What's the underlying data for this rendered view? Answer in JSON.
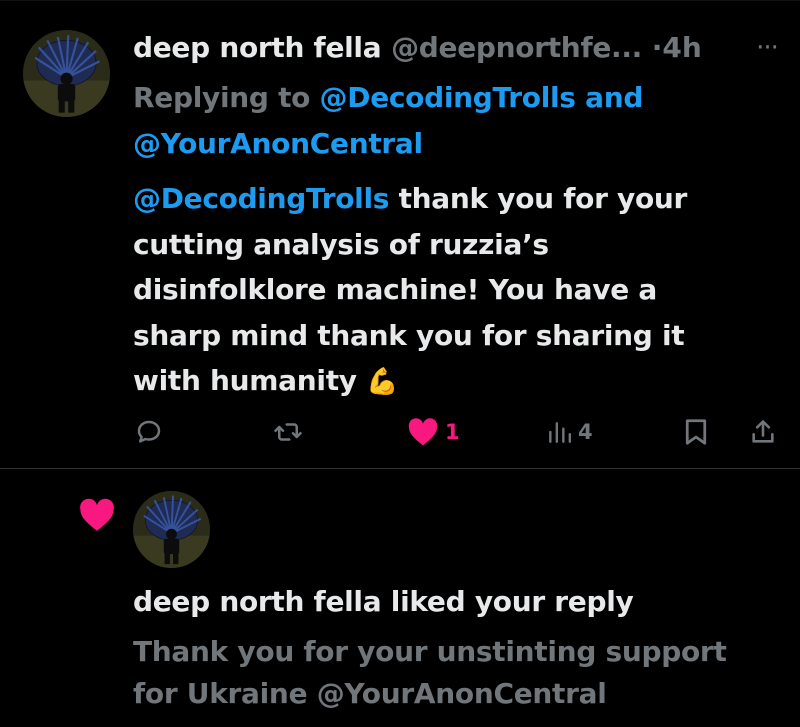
{
  "tweet": {
    "display_name": "deep north fella",
    "handle": "@deepnorthfe...",
    "separator": "·",
    "time": "4h",
    "more_label": "···",
    "replying_prefix": "Replying to ",
    "replying_mention_1": "@DecodingTrolls",
    "replying_and": " and",
    "replying_mention_2": "@YourAnonCentral",
    "body": {
      "mention": "@DecodingTrolls",
      "line1_rest": " thank you for your",
      "line2": "cutting analysis of ruzzia’s",
      "line3": "disinfolklore machine! You have a",
      "line4": "sharp mind thank you for sharing it",
      "line5": "with humanity ",
      "emoji": "💪"
    },
    "actions": {
      "reply_icon": "reply-icon",
      "retweet_icon": "retweet-icon",
      "like_icon": "heart-icon",
      "like_count": "1",
      "views_icon": "views-icon",
      "views_count": "4",
      "bookmark_icon": "bookmark-icon",
      "share_icon": "share-icon"
    }
  },
  "notification": {
    "icon": "heart-icon",
    "title": "deep north fella liked your reply",
    "quote_line1": "Thank you for your unstinting support",
    "quote_line2": "for Ukraine @YourAnonCentral"
  },
  "colors": {
    "background": "#000000",
    "text": "#e7e9ea",
    "muted": "#71767b",
    "accent": "#1d9bf0",
    "like": "#f91880",
    "divider": "#2f3336"
  }
}
